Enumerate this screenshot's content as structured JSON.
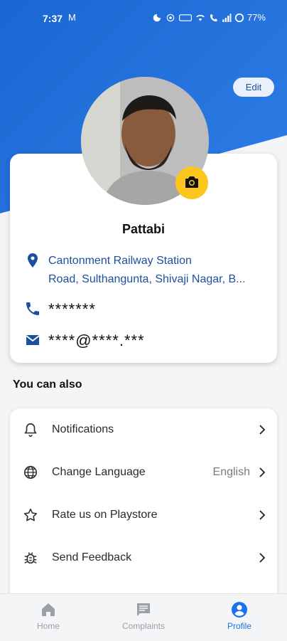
{
  "status_bar": {
    "time": "7:37",
    "message_icon": "M",
    "battery": "77%"
  },
  "header": {
    "edit_label": "Edit"
  },
  "profile": {
    "name": "Pattabi",
    "address_line1": "Cantonment Railway Station",
    "address_line2": "Road, Sulthangunta, Shivaji Nagar, B...",
    "phone": "*******",
    "email": "****@****.***"
  },
  "section": {
    "title": "You can also"
  },
  "menu": {
    "items": [
      {
        "label": "Notifications",
        "value": "",
        "icon": "bell-icon"
      },
      {
        "label": "Change Language",
        "value": "English",
        "icon": "globe-icon"
      },
      {
        "label": "Rate us on Playstore",
        "value": "",
        "icon": "star-icon"
      },
      {
        "label": "Send Feedback",
        "value": "",
        "icon": "bug-icon"
      }
    ]
  },
  "nav": {
    "items": [
      {
        "label": "Home",
        "icon": "home-icon",
        "active": false
      },
      {
        "label": "Complaints",
        "icon": "comment-icon",
        "active": false
      },
      {
        "label": "Profile",
        "icon": "profile-icon",
        "active": true
      }
    ]
  },
  "colors": {
    "primary": "#1a67d3",
    "accent": "#fcc61f",
    "active_nav": "#1a73e8",
    "inactive_nav": "#9aa0a6"
  }
}
